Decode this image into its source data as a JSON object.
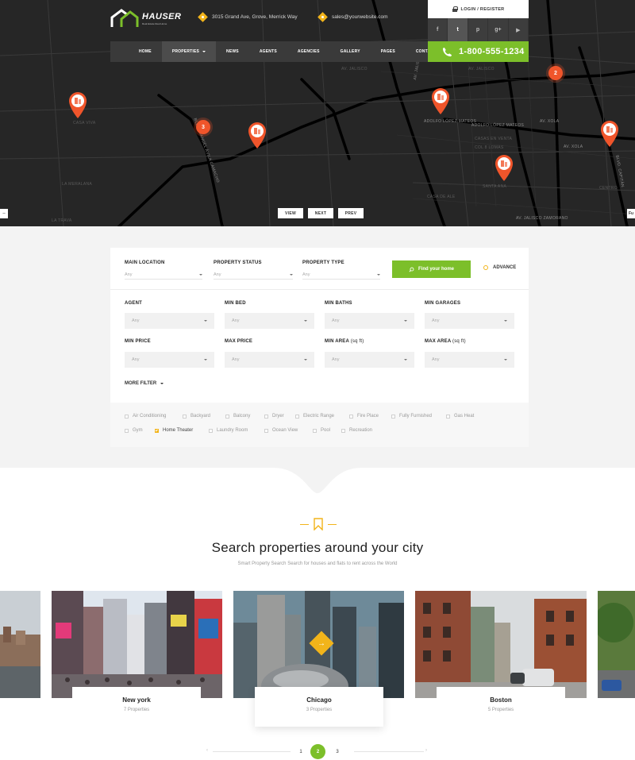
{
  "header": {
    "logo_name": "HAUSER",
    "logo_tagline": "Real Estate Real Home",
    "address": "3015 Grand Ave, Grove, Merrick Way",
    "email": "sales@yourwebsite.com",
    "login_label": "LOGIN / REGISTER",
    "socials": [
      {
        "icon": "facebook-icon",
        "glyph": "f"
      },
      {
        "icon": "twitter-icon",
        "glyph": "t"
      },
      {
        "icon": "pinterest-icon",
        "glyph": "p"
      },
      {
        "icon": "google-plus-icon",
        "glyph": "g+"
      },
      {
        "icon": "youtube-icon",
        "glyph": "▶"
      }
    ],
    "phone": "1-800-555-1234",
    "nav": [
      "HOME",
      "PROPERTIES",
      "NEWS",
      "AGENTS",
      "AGENCIES",
      "GALLERY",
      "PAGES",
      "CONTACTS"
    ]
  },
  "map": {
    "buttons": [
      "VIEW",
      "NEXT",
      "PREV"
    ],
    "clusters": [
      "2",
      "3"
    ],
    "labels": [
      "Adolfo López Mateos",
      "Adolfo López Mateos",
      "Av. Xola",
      "Av. Xola",
      "Av. Jalisco",
      "Av. Jalisco",
      "LA MERALANA",
      "LA TRAVA",
      "CASAS EN VENTA",
      "COL 8 LOMAS",
      "CASA DE ALE",
      "SANTA ANA",
      "Blvd. Manuel Ávila Camacho",
      "Av. Jalisco",
      "CASA VIVA",
      "Av. Jalisco Zamorano",
      "CENTRO",
      "Blvd. Capitán"
    ],
    "edge_right": "Fu"
  },
  "search": {
    "main_location": {
      "label": "MAIN LOCATION",
      "value": "Any"
    },
    "property_status": {
      "label": "PROPERTY STATUS",
      "value": "Any"
    },
    "property_type": {
      "label": "PROPERTY TYPE",
      "value": "Any"
    },
    "find_button": "Find your home",
    "advance": "ADVANCE",
    "row1": [
      {
        "label": "AGENT",
        "value": "Any"
      },
      {
        "label": "MIN BED",
        "value": "Any"
      },
      {
        "label": "MIN BATHS",
        "value": "Any"
      },
      {
        "label": "MIN GARAGES",
        "value": "Any"
      }
    ],
    "row2": [
      {
        "label": "MIN PRICE",
        "sub": "",
        "value": "Any"
      },
      {
        "label": "MAX PRICE",
        "sub": "",
        "value": "Any"
      },
      {
        "label": "MIN AREA",
        "sub": "(sq ft)",
        "value": "Any"
      },
      {
        "label": "MAX AREA",
        "sub": "(sq ft)",
        "value": "Any"
      }
    ],
    "more_filter": "MORE FILTER",
    "amenities_row1": [
      "Air Conditioning",
      "Backyard",
      "Balcony",
      "Dryer",
      "Electric Range",
      "Fire Place",
      "Fully Furnished",
      "Gas Heat"
    ],
    "amenities_row2": [
      "Gym",
      "Home Theater",
      "Laundry Room",
      "Ocean View",
      "Pool",
      "Recreation"
    ],
    "checked": [
      "Home Theater"
    ]
  },
  "cities_section": {
    "title": "Search properties around your city",
    "subtitle": "Smart Property Search Search for houses and flats to rent across the World",
    "cities": [
      {
        "name": "New york",
        "count": "7 Properties"
      },
      {
        "name": "Chicago",
        "count": "3 Properties"
      },
      {
        "name": "Boston",
        "count": "5 Properties"
      }
    ]
  },
  "pagination": {
    "pages": [
      "1",
      "2",
      "3"
    ],
    "active": "2",
    "prev": "‹",
    "next": "›"
  },
  "colors": {
    "accent_green": "#7cbf2a",
    "accent_yellow": "#f2b41a",
    "pin_orange": "#f0552b",
    "dark": "#262626"
  }
}
